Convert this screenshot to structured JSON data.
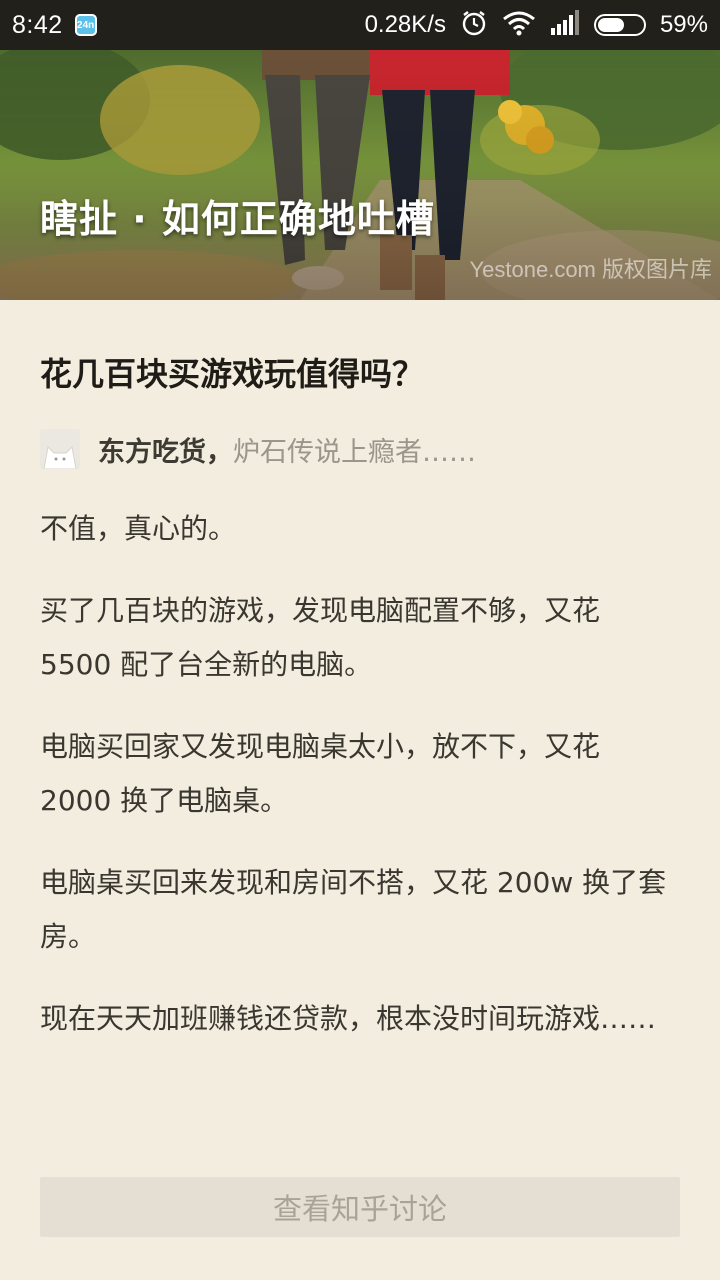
{
  "status_bar": {
    "time": "8:42",
    "app_icon_label": "24n",
    "net_speed": "0.28K/s",
    "battery_text": "59%",
    "battery_level": 0.59
  },
  "header": {
    "title": "瞎扯 · 如何正确地吐槽",
    "watermark": "Yestone.com 版权图片库"
  },
  "article": {
    "question": "花几百块买游戏玩值得吗？",
    "author_name": "东方吃货，",
    "author_bio": "炉石传说上瘾者……",
    "paragraphs": [
      "不值，真心的。",
      "买了几百块的游戏，发现电脑配置不够，又花 5500 配了台全新的电脑。",
      "电脑买回家又发现电脑桌太小，放不下，又花 2000 换了电脑桌。",
      "电脑桌买回来发现和房间不搭，又花 200w 换了套房。",
      "现在天天加班赚钱还贷款，根本没时间玩游戏……"
    ]
  },
  "discuss_button": "查看知乎讨论",
  "colors": {
    "background": "#f2eddf",
    "status_bar": "#22201a",
    "button_bg": "#e4dfd2",
    "button_text": "#a8a398"
  }
}
